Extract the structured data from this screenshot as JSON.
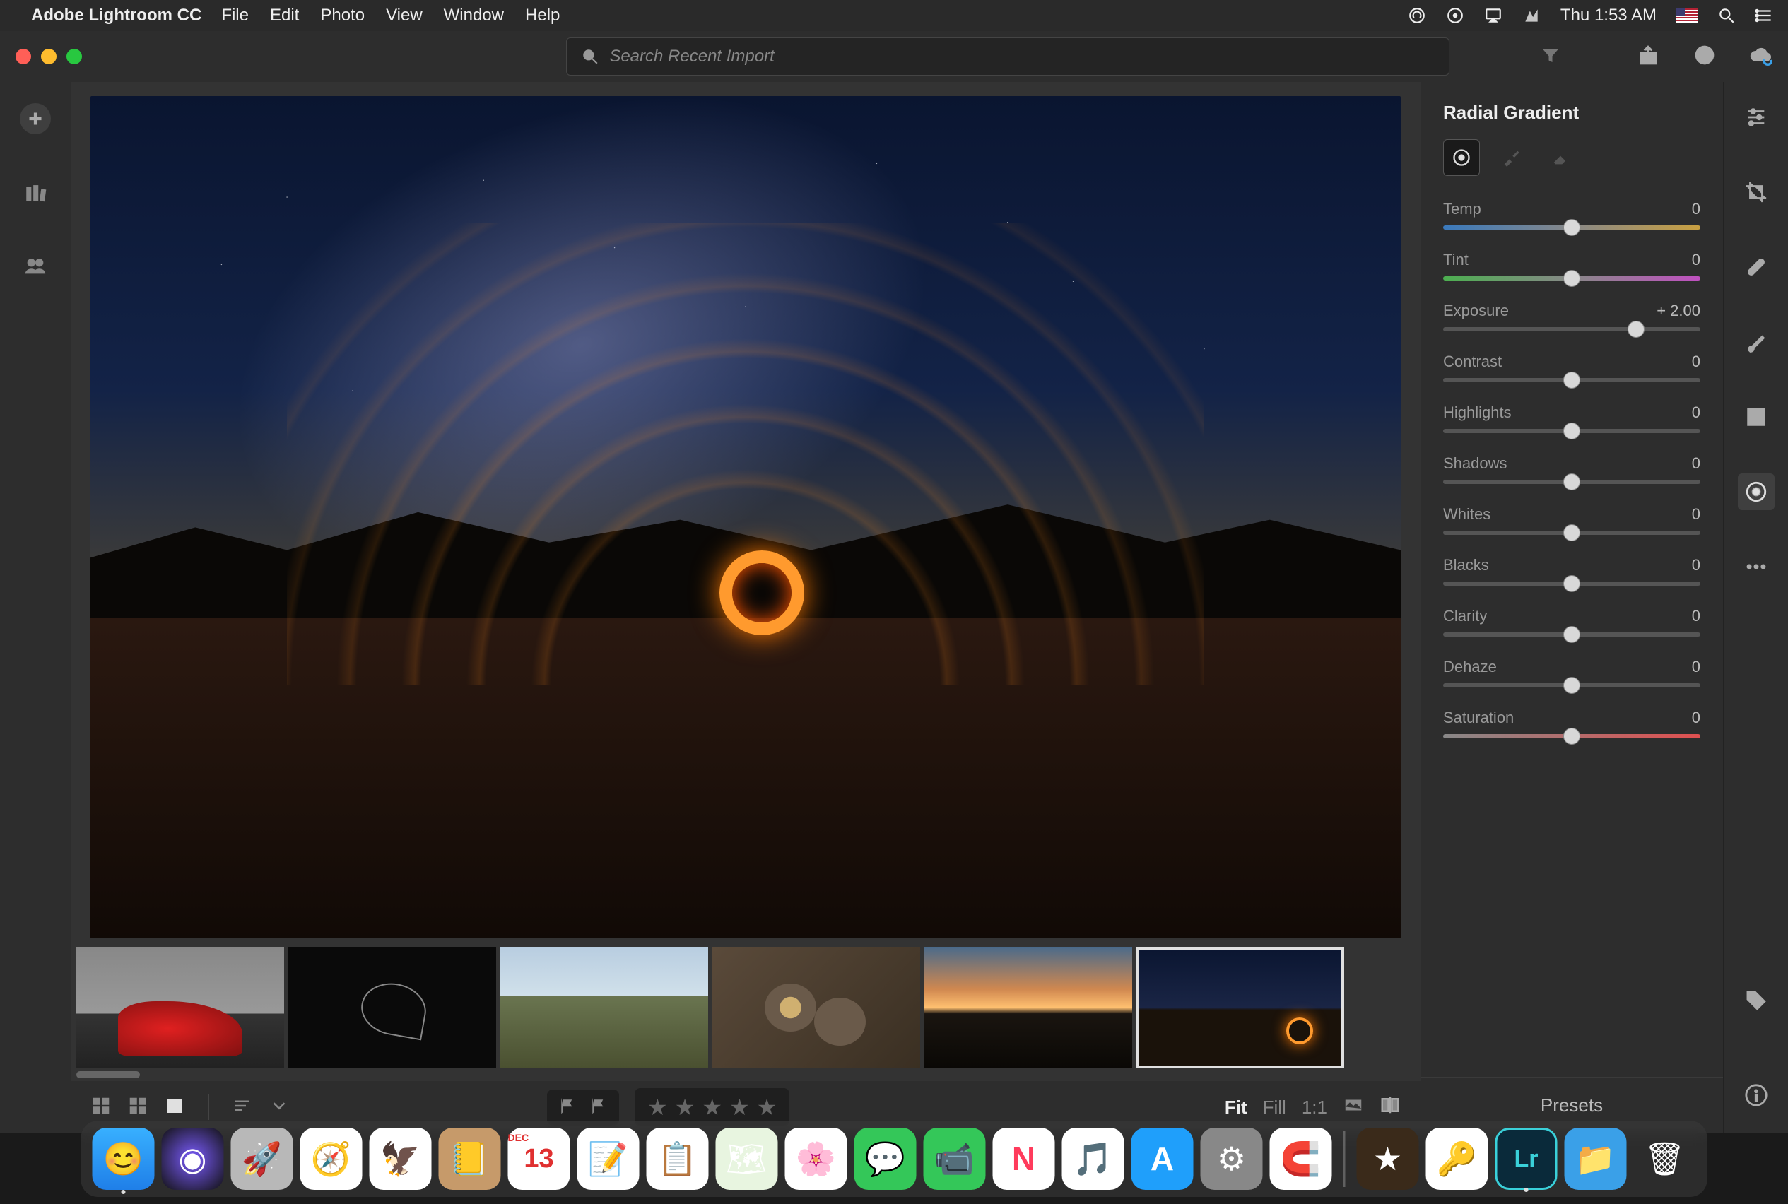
{
  "menubar": {
    "app_name": "Adobe Lightroom CC",
    "items": [
      "File",
      "Edit",
      "Photo",
      "View",
      "Window",
      "Help"
    ],
    "clock": "Thu 1:53 AM"
  },
  "traffic": {
    "close": "#ff5f57",
    "min": "#febc2e",
    "max": "#28c840"
  },
  "search": {
    "placeholder": "Search Recent Import"
  },
  "radial_panel": {
    "title": "Radial Gradient",
    "sliders": [
      {
        "label": "Temp",
        "value": "0",
        "pos": 50,
        "track": "linear-gradient(to right,#3a7abd,#888,#c9a040)"
      },
      {
        "label": "Tint",
        "value": "0",
        "pos": 50,
        "track": "linear-gradient(to right,#4caf50,#888,#c050c0)"
      },
      {
        "label": "Exposure",
        "value": "+ 2.00",
        "pos": 75,
        "track": "#555"
      },
      {
        "label": "Contrast",
        "value": "0",
        "pos": 50,
        "track": "#555"
      },
      {
        "label": "Highlights",
        "value": "0",
        "pos": 50,
        "track": "#555"
      },
      {
        "label": "Shadows",
        "value": "0",
        "pos": 50,
        "track": "#555"
      },
      {
        "label": "Whites",
        "value": "0",
        "pos": 50,
        "track": "#555"
      },
      {
        "label": "Blacks",
        "value": "0",
        "pos": 50,
        "track": "#555"
      },
      {
        "label": "Clarity",
        "value": "0",
        "pos": 50,
        "track": "#555"
      },
      {
        "label": "Dehaze",
        "value": "0",
        "pos": 50,
        "track": "#555"
      },
      {
        "label": "Saturation",
        "value": "0",
        "pos": 50,
        "track": "linear-gradient(to right,#888,#e05050)"
      }
    ],
    "presets_label": "Presets"
  },
  "zoom": {
    "fit": "Fit",
    "fill": "Fill",
    "one": "1:1"
  },
  "thumbs": [
    {
      "name": "car"
    },
    {
      "name": "dark"
    },
    {
      "name": "mtn"
    },
    {
      "name": "coffee"
    },
    {
      "name": "sunset"
    },
    {
      "name": "fire"
    }
  ],
  "dock": [
    {
      "name": "finder",
      "bg": "linear-gradient(#38b0ff,#1f7fe8)",
      "glyph": "😊",
      "running": true
    },
    {
      "name": "siri",
      "bg": "radial-gradient(circle at 50% 50%,#7b5cff,#111)",
      "glyph": "◉"
    },
    {
      "name": "launchpad",
      "bg": "#b8b8b8",
      "glyph": "🚀"
    },
    {
      "name": "safari",
      "bg": "#fff",
      "glyph": "🧭"
    },
    {
      "name": "mail",
      "bg": "#fff",
      "glyph": "🦅"
    },
    {
      "name": "contacts",
      "bg": "#c69a6a",
      "glyph": "📒"
    },
    {
      "name": "calendar",
      "bg": "#fff",
      "glyph": "13"
    },
    {
      "name": "notes",
      "bg": "#fff",
      "glyph": "📝"
    },
    {
      "name": "reminders",
      "bg": "#fff",
      "glyph": "📋"
    },
    {
      "name": "maps",
      "bg": "#e8f5e0",
      "glyph": "🗺"
    },
    {
      "name": "photos",
      "bg": "#fff",
      "glyph": "🌸"
    },
    {
      "name": "messages",
      "bg": "#34c759",
      "glyph": "💬"
    },
    {
      "name": "facetime",
      "bg": "#34c759",
      "glyph": "📹"
    },
    {
      "name": "news",
      "bg": "#fff",
      "glyph": "N"
    },
    {
      "name": "itunes",
      "bg": "#fff",
      "glyph": "🎵"
    },
    {
      "name": "appstore",
      "bg": "#1f9ffb",
      "glyph": "A"
    },
    {
      "name": "settings",
      "bg": "#888",
      "glyph": "⚙"
    },
    {
      "name": "magnet",
      "bg": "#fff",
      "glyph": "🧲"
    }
  ],
  "dock_right": [
    {
      "name": "imovie",
      "bg": "#3a2a1a",
      "glyph": "★"
    },
    {
      "name": "1password",
      "bg": "#fff",
      "glyph": "🔑"
    },
    {
      "name": "lightroom",
      "bg": "#0a2a3a",
      "glyph": "Lr",
      "running": true
    },
    {
      "name": "downloads",
      "bg": "#3aa0e8",
      "glyph": "📁"
    },
    {
      "name": "trash",
      "bg": "transparent",
      "glyph": "🗑"
    }
  ]
}
